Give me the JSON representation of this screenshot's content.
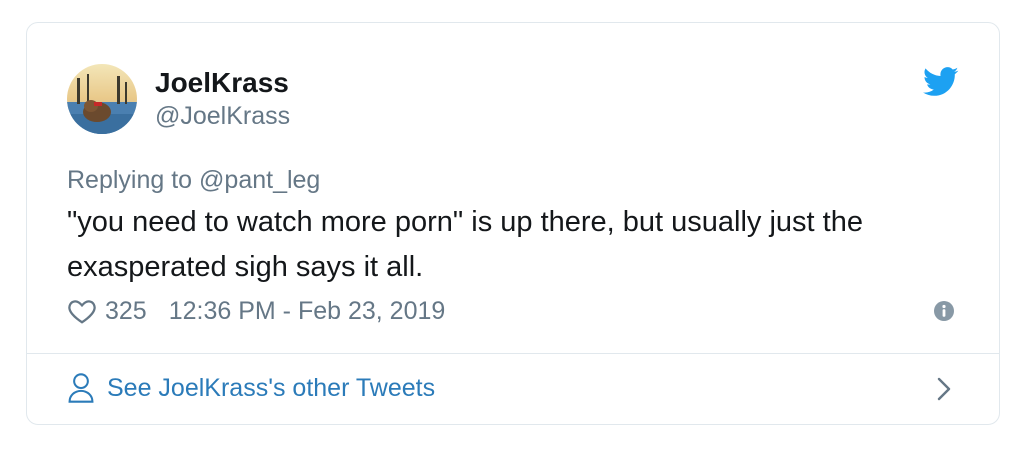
{
  "tweet": {
    "display_name": "JoelKrass",
    "handle": "@JoelKrass",
    "reply_prefix": "Replying to",
    "reply_to": "@pant_leg",
    "text": "\"you need to watch more porn\" is up there, but usually just the exasperated sigh says it all.",
    "likes": "325",
    "timestamp": "12:36 PM - Feb 23, 2019"
  },
  "footer": {
    "link_label": "See JoelKrass's other Tweets"
  },
  "icons": {
    "brand": "twitter-bird-icon",
    "like": "heart-icon",
    "info": "info-icon",
    "profile": "person-icon",
    "next": "chevron-right-icon"
  },
  "colors": {
    "brand_blue": "#1da1f2",
    "text": "#14171a",
    "secondary": "#657786",
    "link": "#2b7bb9",
    "border": "#e1e8ed"
  }
}
